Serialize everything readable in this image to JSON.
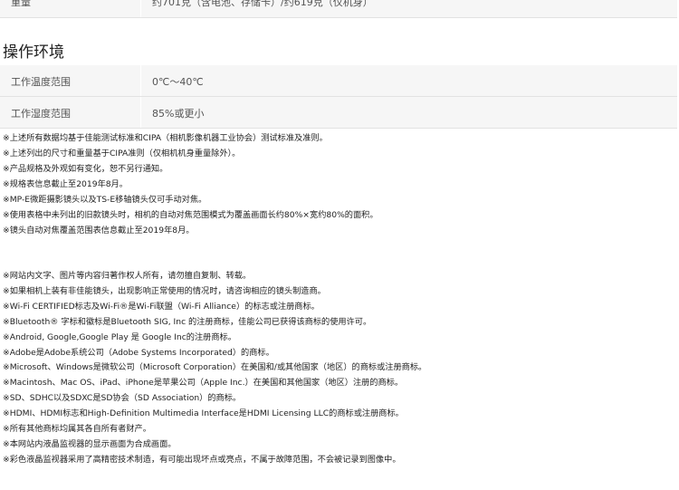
{
  "weight_row": {
    "label": "重量",
    "value": "约701克（含电池、存储卡）/约619克（仅机身）"
  },
  "section_title": "操作环境",
  "operating_environment": [
    {
      "label": "工作温度范围",
      "value": "0℃～40℃"
    },
    {
      "label": "工作湿度范围",
      "value": "85%或更小"
    }
  ],
  "notes_group_1": [
    "※上述所有数据均基于佳能测试标准和CIPA（相机影像机器工业协会）测试标准及准则。",
    "※上述列出的尺寸和重量基于CIPA准则（仅相机机身重量除外）。",
    "※产品规格及外观如有变化，恕不另行通知。",
    "※规格表信息截止至2019年8月。"
  ],
  "notes_group_2": [
    "※MP-E微距摄影镜头以及TS-E移轴镜头仅可手动对焦。",
    "※使用表格中未列出的旧款镜头时，相机的自动对焦范围模式为覆盖画面长约80%×宽约80%的面积。",
    "※镜头自动对焦覆盖范围表信息截止至2019年8月。"
  ],
  "notes_group_3": [
    "※网站内文字、图片等内容归著作权人所有，请勿擅自复制、转载。",
    "※如果相机上装有非佳能镜头，出现影响正常使用的情况时，请咨询相应的镜头制造商。",
    "※Wi-Fi CERTIFIED标志及Wi-Fi®是Wi-Fi联盟（Wi-Fi Alliance）的标志或注册商标。",
    "※Bluetooth® 字标和徽标是Bluetooth SIG, Inc 的注册商标，佳能公司已获得该商标的使用许可。",
    "※Android, Google,Google Play 是 Google Inc的注册商标。",
    "※Adobe是Adobe系统公司（Adobe Systems Incorporated）的商标。",
    "※Microsoft、Windows是微软公司（Microsoft Corporation）在美国和/或其他国家（地区）的商标或注册商标。",
    "※Macintosh、Mac OS、iPad、iPhone是苹果公司（Apple Inc.）在美国和其他国家（地区）注册的商标。",
    "※SD、SDHC以及SDXC是SD协会（SD Association）的商标。",
    "※HDMI、HDMI标志和High-Definition Multimedia Interface是HDMI Licensing LLC的商标或注册商标。",
    "※所有其他商标均属其各自所有者财产。",
    "※本网站内液晶监视器的显示画面为合成画面。",
    "※彩色液晶监视器采用了高精密技术制造，有可能出现坏点或亮点，不属于故障范围，不会被记录到图像中。"
  ]
}
